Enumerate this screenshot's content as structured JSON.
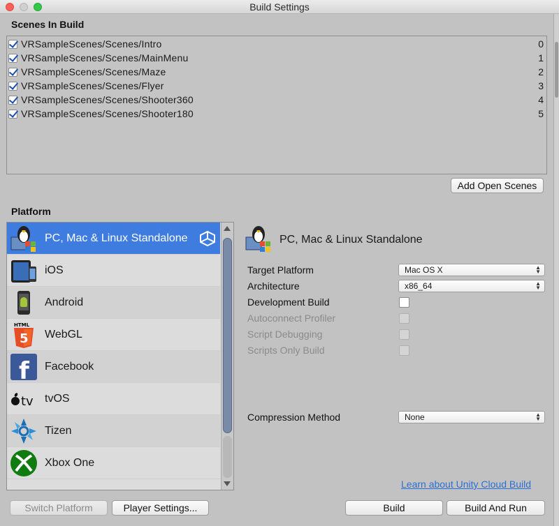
{
  "window": {
    "title": "Build Settings"
  },
  "scenes": {
    "header": "Scenes In Build",
    "items": [
      {
        "name": "VRSampleScenes/Scenes/Intro",
        "index": "0",
        "checked": true
      },
      {
        "name": "VRSampleScenes/Scenes/MainMenu",
        "index": "1",
        "checked": true
      },
      {
        "name": "VRSampleScenes/Scenes/Maze",
        "index": "2",
        "checked": true
      },
      {
        "name": "VRSampleScenes/Scenes/Flyer",
        "index": "3",
        "checked": true
      },
      {
        "name": "VRSampleScenes/Scenes/Shooter360",
        "index": "4",
        "checked": true
      },
      {
        "name": "VRSampleScenes/Scenes/Shooter180",
        "index": "5",
        "checked": true
      }
    ],
    "add_open_scenes": "Add Open Scenes"
  },
  "platform": {
    "header": "Platform",
    "items": [
      {
        "label": "PC, Mac & Linux Standalone",
        "icon": "standalone-icon"
      },
      {
        "label": "iOS",
        "icon": "ios-device-icon"
      },
      {
        "label": "Android",
        "icon": "android-icon"
      },
      {
        "label": "WebGL",
        "icon": "html5-icon"
      },
      {
        "label": "Facebook",
        "icon": "facebook-icon"
      },
      {
        "label": "tvOS",
        "icon": "apple-tv-icon"
      },
      {
        "label": "Tizen",
        "icon": "tizen-icon"
      },
      {
        "label": "Xbox One",
        "icon": "xbox-icon"
      }
    ],
    "selected": "PC, Mac & Linux Standalone"
  },
  "details": {
    "title": "PC, Mac & Linux Standalone",
    "target_platform": {
      "label": "Target Platform",
      "value": "Mac OS X"
    },
    "architecture": {
      "label": "Architecture",
      "value": "x86_64"
    },
    "development_build": {
      "label": "Development Build",
      "checked": false
    },
    "autoconnect_profiler": {
      "label": "Autoconnect Profiler",
      "enabled": false
    },
    "script_debugging": {
      "label": "Script Debugging",
      "enabled": false
    },
    "scripts_only_build": {
      "label": "Scripts Only Build",
      "enabled": false
    },
    "compression_method": {
      "label": "Compression Method",
      "value": "None"
    },
    "cloud_link": "Learn about Unity Cloud Build"
  },
  "buttons": {
    "switch_platform": "Switch Platform",
    "player_settings": "Player Settings...",
    "build": "Build",
    "build_and_run": "Build And Run"
  },
  "colors": {
    "selection": "#3e7ce0",
    "link": "#2a6fd6",
    "background": "#c2c2c2"
  }
}
